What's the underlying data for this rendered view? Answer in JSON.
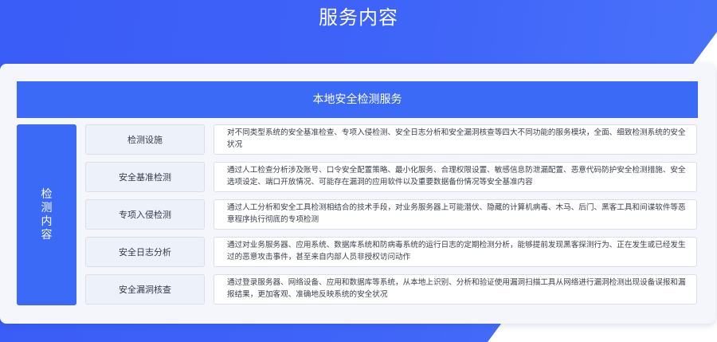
{
  "page": {
    "title": "服务内容"
  },
  "service": {
    "header": "本地安全检测服务",
    "side_label": "检测内容",
    "rows": [
      {
        "name": "检测设施",
        "desc": "对不同类型系统的安全基准检查、专项入侵检测、安全日志分析和安全漏洞核查等四大不同功能的服务模块，全面、细致检测系统的安全状况"
      },
      {
        "name": "安全基准检测",
        "desc": "通过人工检查分析涉及账号、口令安全配置策略、最小化服务、合理权限设置、敏感信息防泄漏配置、恶意代码防护安全检测措施、安全选项设定、端口开放情况、可能存在漏洞的应用软件以及重要数据备份情况等安全基准内容"
      },
      {
        "name": "专项入侵检测",
        "desc": "通过人工分析和安全工具检测相结合的技术手段，对业务服务器上可能潜伏、隐藏的计算机病毒、木马、后门、黑客工具和间谍软件等恶意程序执行彻底的专项检测"
      },
      {
        "name": "安全日志分析",
        "desc": "通过对业务服务器、应用系统、数据库系统和防病毒系统的运行日志的定期检测分析，能够提前发现黑客探测行为、正在发生或已经发生过的恶意攻击事件，甚至来自内部人员非授权访问动作"
      },
      {
        "name": "安全漏洞核查",
        "desc": "通过登录服务器、网络设备、应用和数据库等系统，从本地上识别、分析和验证使用漏洞扫描工具从网络进行漏洞检测出现设备误报和漏报结果，更加客观、准确地反映系统的安全状况"
      }
    ]
  },
  "colors": {
    "brand_blue": "#3b6af6",
    "background_blue": "#3f64f8",
    "card_bg": "#f4f6fc"
  }
}
